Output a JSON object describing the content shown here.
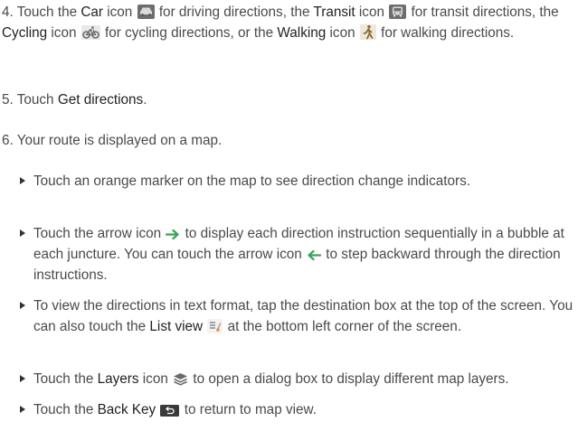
{
  "steps": [
    {
      "num": "4.",
      "p1": "Touch the",
      "car": "Car",
      "p2": "icon",
      "p3": "for driving directions, the",
      "transit": "Transit",
      "p4": "icon",
      "p5": "for transit directions, the",
      "cycling": "Cycling",
      "p6": "icon",
      "p7": "for cycling directions, or the",
      "walking": "Walking",
      "p8": "icon",
      "p9": "for walking directions."
    },
    {
      "num": "5.",
      "p1": "Touch",
      "bold": "Get directions",
      "p2": "."
    },
    {
      "num": "6.",
      "p1": "Your route is displayed on a map."
    }
  ],
  "bullets": [
    {
      "text": "Touch an orange marker on the map to see direction change indicators."
    },
    {
      "p1": "Touch the arrow icon",
      "p2": "to display each direction instruction sequentially in a bubble at each juncture. You can touch the arrow icon",
      "p3": "to step backward through the direction instructions."
    },
    {
      "p1": "To view the directions in text format, tap the destination box at the top of the screen. You can also touch the",
      "bold": "List view",
      "p2": "at the bottom left corner of the screen."
    },
    {
      "p1": "Touch the",
      "bold": "Layers",
      "p2": "icon",
      "p3": "to open a dialog box to display different map layers."
    },
    {
      "p1": "Touch the",
      "bold": "Back Key",
      "p2": "to return to map view."
    }
  ],
  "colors": {
    "text": "#4a4a4a",
    "bold": "#222222",
    "arrow": "#3aa357",
    "walking": "#8b6f2f"
  },
  "icons": [
    "car-icon",
    "transit-icon",
    "cycling-icon",
    "walking-icon",
    "arrow-right-icon",
    "arrow-left-icon",
    "list-view-icon",
    "layers-icon",
    "back-key-icon"
  ]
}
